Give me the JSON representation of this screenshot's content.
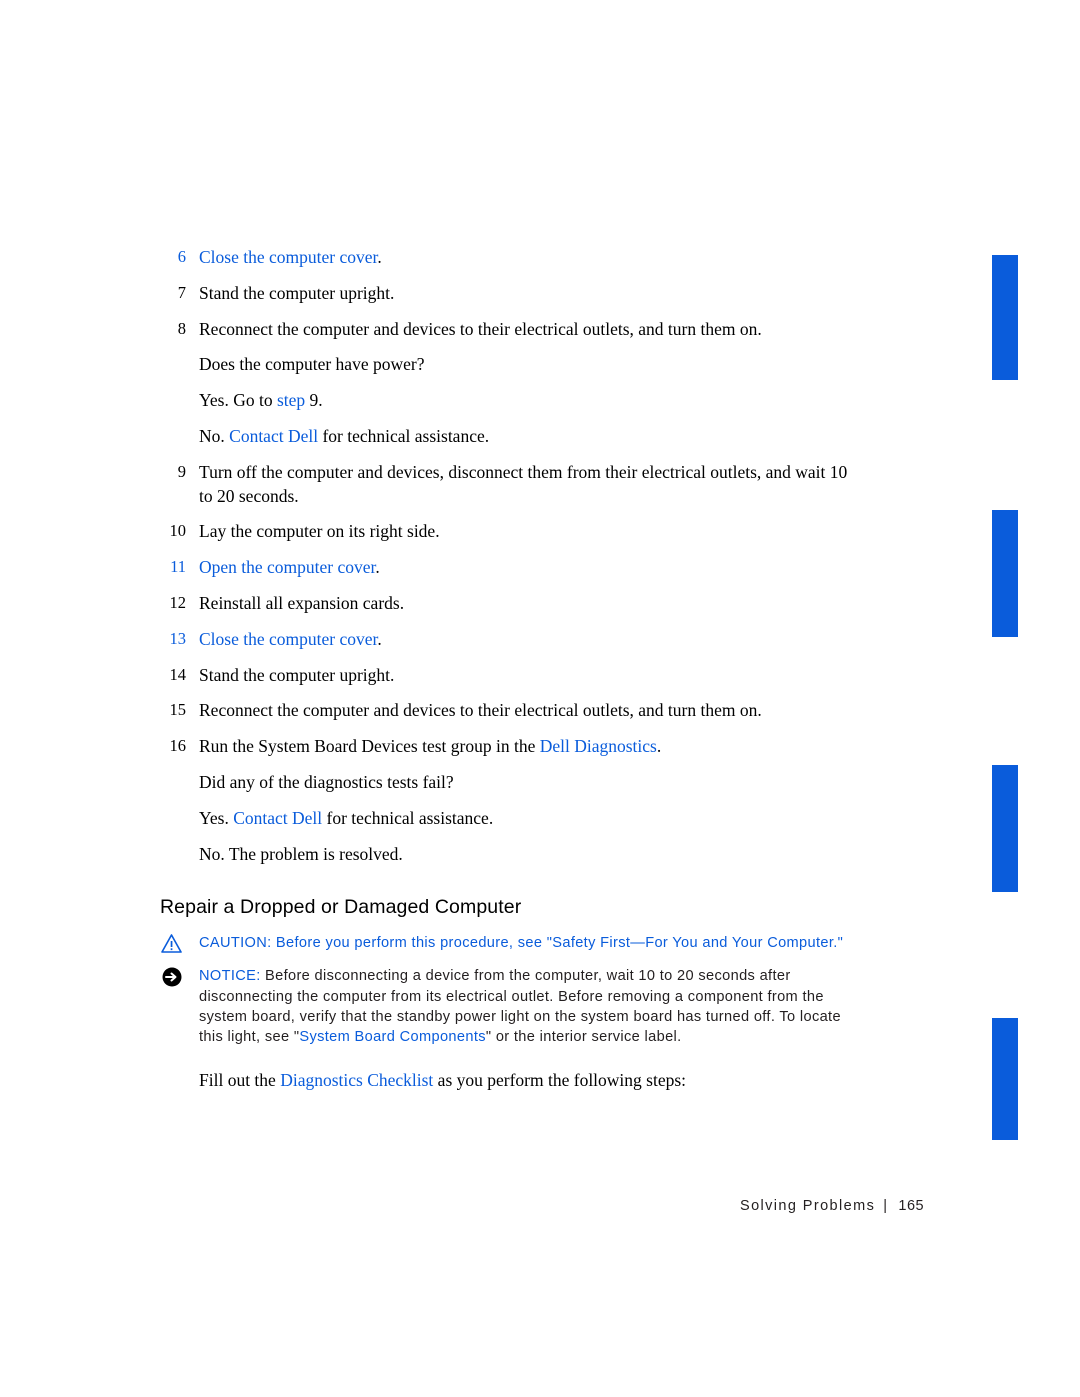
{
  "page": {
    "footer_section": "Solving Problems",
    "footer_separator": "|",
    "footer_page_number": "165"
  },
  "steps": [
    {
      "num": "6",
      "text": "Close the computer cover",
      "period": ".",
      "link": true
    },
    {
      "num": "7",
      "text": "Stand the computer upright.",
      "period": "",
      "link": false
    },
    {
      "num": "8",
      "text": "Reconnect the computer and devices to their electrical outlets, and turn them on.",
      "period": "",
      "link": false
    }
  ],
  "interleaved": {
    "q1": "Does the computer have power?",
    "yes1_pre": "Yes. Go to ",
    "yes1_link": "step",
    "yes1_post": " 9.",
    "no1_pre": "No. ",
    "no1_link": "Contact Dell",
    "no1_post": " for technical assistance."
  },
  "steps2": [
    {
      "num": "9",
      "text": "Turn off the computer and devices, disconnect them from their electrical outlets, and wait 10 to 20 seconds.",
      "period": "",
      "link": false
    },
    {
      "num": "10",
      "text": "Lay the computer on its right side.",
      "period": "",
      "link": false
    },
    {
      "num": "11",
      "text": "Open the computer cover",
      "period": ".",
      "link": true
    },
    {
      "num": "12",
      "text": "Reinstall all expansion cards.",
      "period": "",
      "link": false
    },
    {
      "num": "13",
      "text": "Close the computer cover",
      "period": ".",
      "link": true
    },
    {
      "num": "14",
      "text": "Stand the computer upright.",
      "period": "",
      "link": false
    },
    {
      "num": "15",
      "text": "Reconnect the computer and devices to their electrical outlets, and turn them on.",
      "period": "",
      "link": false
    }
  ],
  "step16": {
    "num": "16",
    "pre": "Run the System Board Devices test group in the ",
    "link": "Dell Diagnostics",
    "post": "."
  },
  "interleaved2": {
    "q2": "Did any of the diagnostics tests fail?",
    "yes2_pre": "Yes. ",
    "yes2_link": "Contact Dell",
    "yes2_post": " for technical assistance.",
    "no2": "No. The problem is resolved."
  },
  "section": {
    "title": "Repair a Dropped or Damaged Computer"
  },
  "caution": {
    "keyword": "CAUTION:",
    "text_pre": " Before you perform this procedure, see \"",
    "link": "Safety First—For You and Your Computer",
    "text_post": ".\"",
    "icon": "caution-triangle-icon"
  },
  "notice": {
    "keyword": "NOTICE:",
    "text_pre": " Before disconnecting a device from the computer, wait 10 to 20 seconds after disconnecting the computer from its electrical outlet. Before removing a component from the system board, verify that the standby power light on the system board has turned off. To locate this light, see \"",
    "link": "System Board Components",
    "text_post": "\" or the interior service label.",
    "icon": "notice-arrow-icon"
  },
  "fillout": {
    "pre": "Fill out the ",
    "link": "Diagnostics Checklist",
    "post": " as you perform the following steps:"
  },
  "colors": {
    "link": "#0a5cdb",
    "text": "#000000",
    "tab_marker": "#0a5cdb"
  }
}
